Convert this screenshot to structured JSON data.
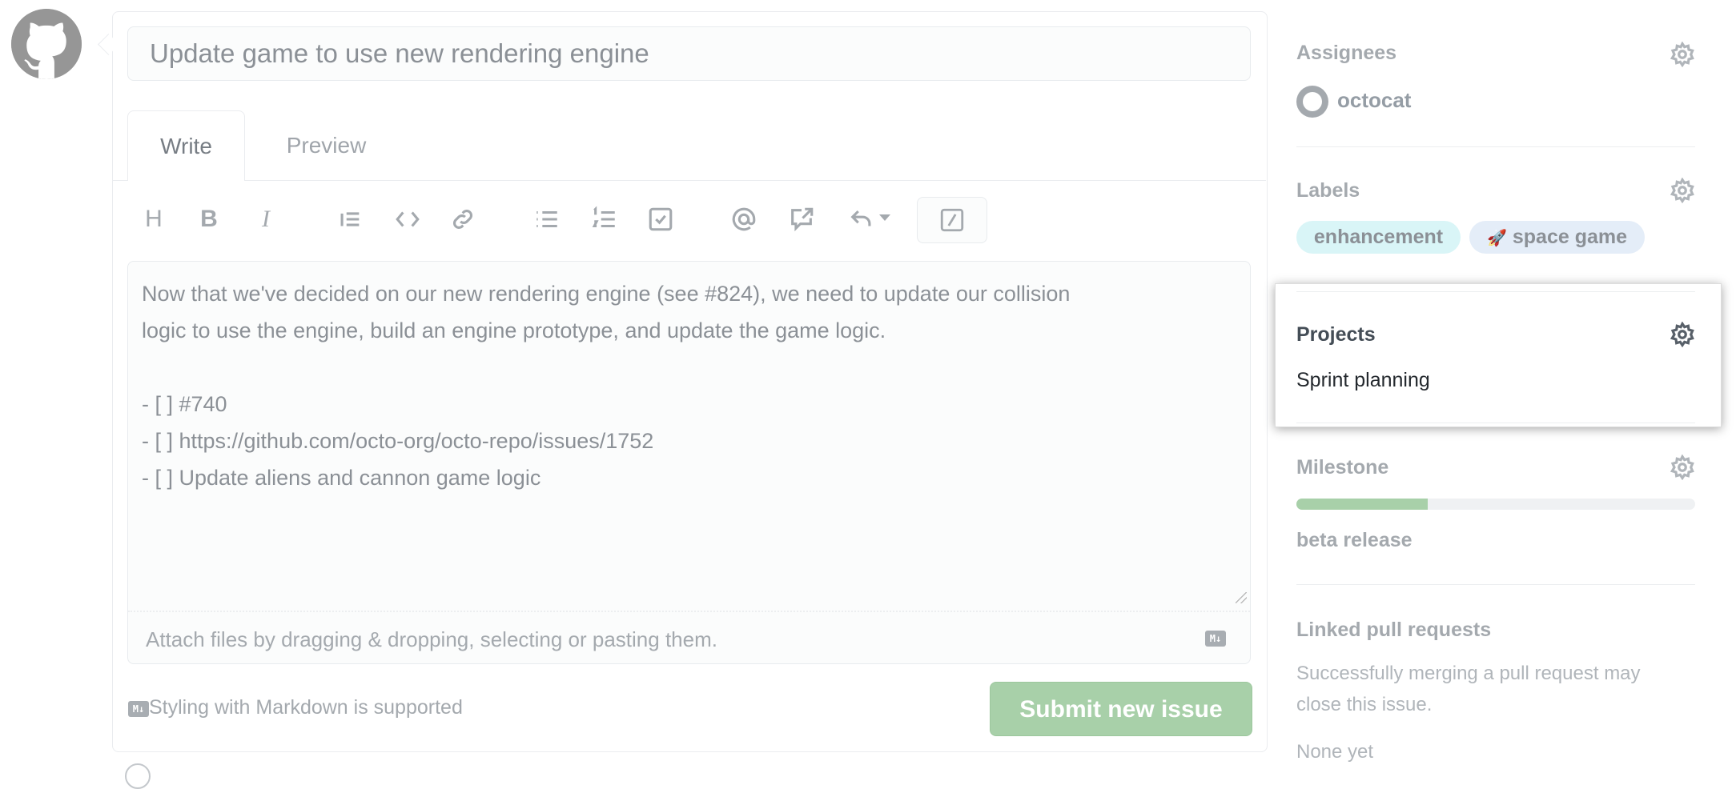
{
  "issue": {
    "title": "Update game to use new rendering engine",
    "tabs": [
      {
        "label": "Write"
      },
      {
        "label": "Preview"
      }
    ],
    "toolbar": {
      "heading": "H",
      "bold": "B",
      "italic": "I"
    },
    "body_lines": [
      "Now that we've decided on our new rendering engine (see #824), we need to update our collision",
      "logic to use the engine, build an engine prototype, and update the game logic.",
      "- [ ] #740",
      "- [ ] https://github.com/octo-org/octo-repo/issues/1752",
      "- [ ] Update aliens and cannon game logic"
    ],
    "attach_text": "Attach files by dragging & dropping, selecting or pasting them.",
    "markdown_badge": "M↓",
    "markdown_note": "Styling with Markdown is supported",
    "submit_label": "Submit new issue"
  },
  "sidebar": {
    "assignees": {
      "heading": "Assignees",
      "user": "octocat"
    },
    "labels": {
      "heading": "Labels",
      "items": [
        {
          "name": "enhancement",
          "color": "#d9f5f7"
        },
        {
          "emoji": "🚀",
          "name": "space game",
          "color": "#e4edf8"
        }
      ]
    },
    "projects": {
      "heading": "Projects",
      "value": "Sprint planning"
    },
    "milestone": {
      "heading": "Milestone",
      "progress_percent": 33,
      "name": "beta release",
      "bar_color": "#a8d0a9"
    },
    "linked_prs": {
      "heading": "Linked pull requests",
      "description_lines": [
        "Successfully merging a pull request may",
        "close this issue."
      ],
      "value": "None yet"
    }
  }
}
